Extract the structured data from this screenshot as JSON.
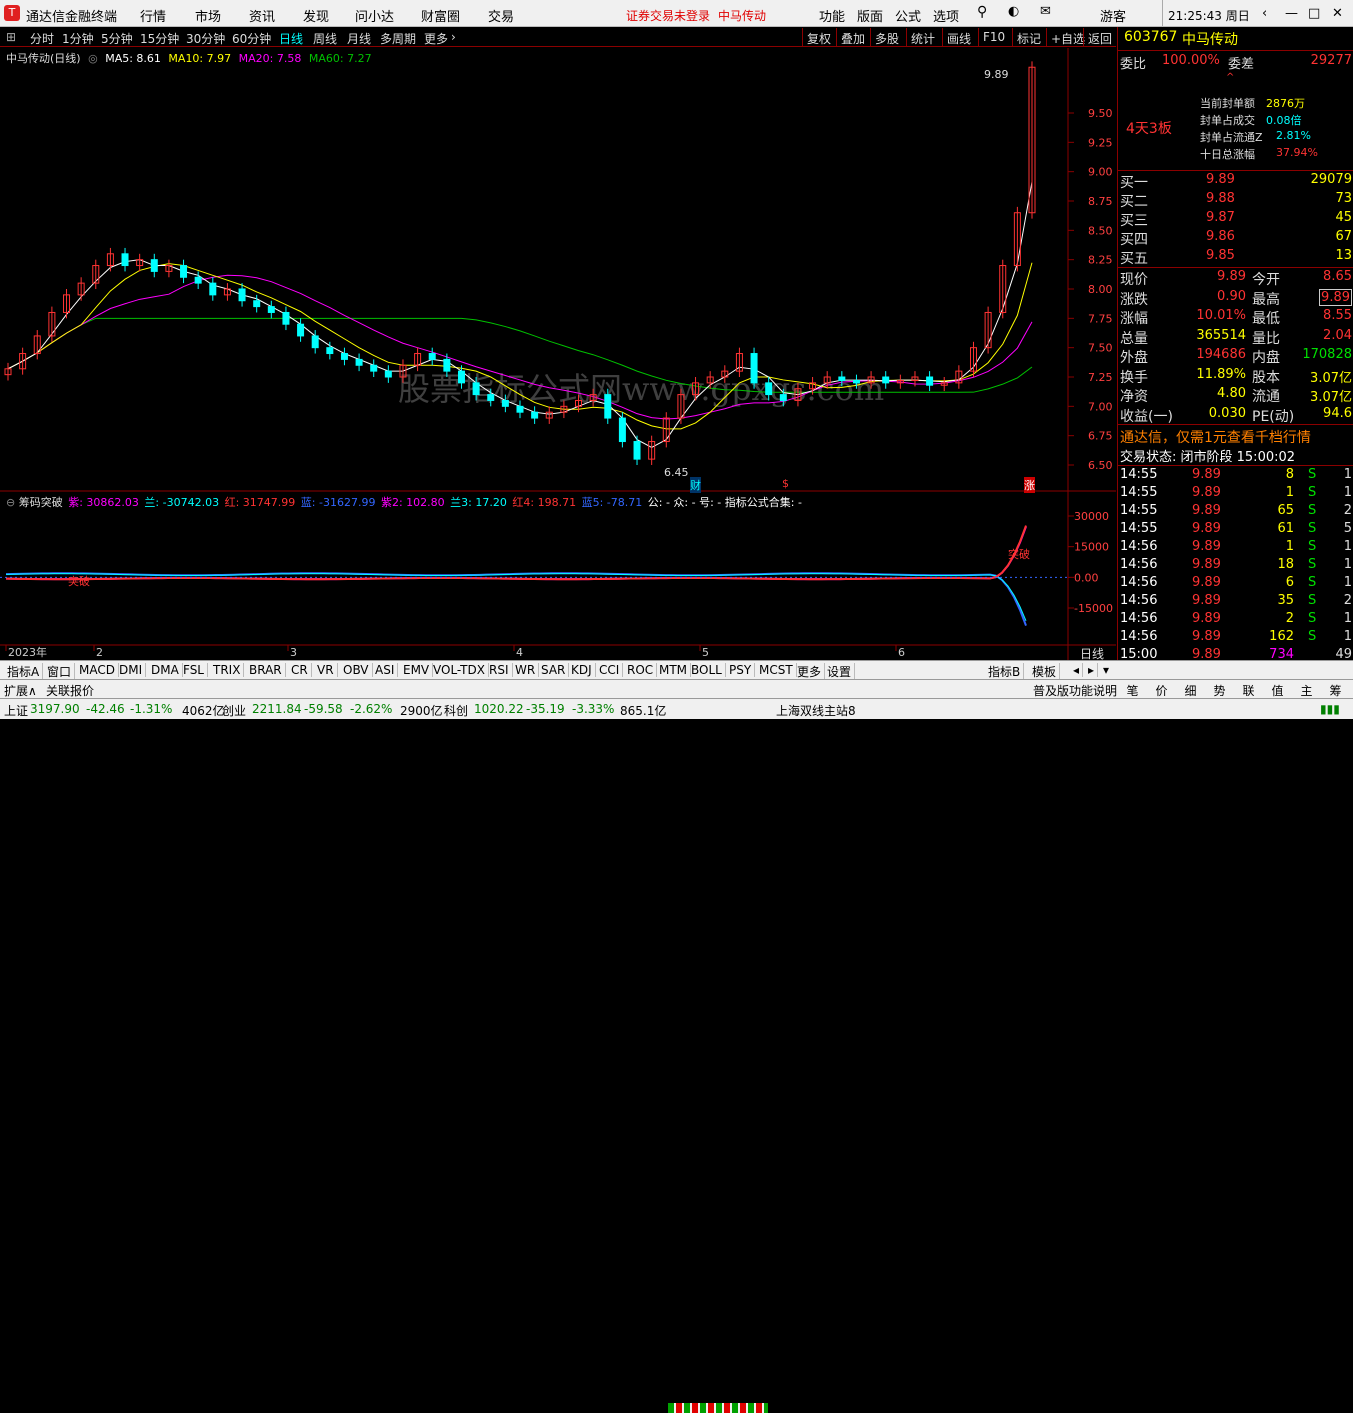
{
  "menubar": {
    "app_title": "通达信金融终端",
    "items": [
      "行情",
      "市场",
      "资讯",
      "发现",
      "问小达",
      "财富圈",
      "交易"
    ],
    "notice": "证券交易未登录",
    "stock_name": "中马传动",
    "right_items": [
      "功能",
      "版面",
      "公式",
      "选项"
    ],
    "guest": "游客",
    "clock": "21:25:43 周日"
  },
  "toolbar": {
    "periods": [
      "分时",
      "1分钟",
      "5分钟",
      "15分钟",
      "30分钟",
      "60分钟",
      "日线",
      "周线",
      "月线",
      "多周期",
      "更多"
    ],
    "active": "日线",
    "buttons": [
      "复权",
      "叠加",
      "多股",
      "统计",
      "画线",
      "F10",
      "标记",
      "+自选",
      "返回"
    ]
  },
  "chart": {
    "title": "中马传动(日线)",
    "ma": [
      {
        "label": "MA5: 8.61",
        "color": "#ffffff"
      },
      {
        "label": "MA10: 7.97",
        "color": "#ffff00"
      },
      {
        "label": "MA20: 7.58",
        "color": "#ff00ff"
      },
      {
        "label": "MA60: 7.27",
        "color": "#00c000"
      }
    ],
    "y_ticks": [
      "9.50",
      "9.25",
      "9.00",
      "8.75",
      "8.50",
      "8.25",
      "8.00",
      "7.75",
      "7.50",
      "7.25",
      "7.00",
      "6.75",
      "6.50"
    ],
    "high_label": "9.89",
    "low_label": "6.45",
    "markers": [
      "财",
      "$",
      "涨"
    ],
    "watermark": "股票指标公式网www.gpxgs.com",
    "x_labels": [
      "2023年",
      "2",
      "3",
      "4",
      "5",
      "6"
    ],
    "right_axis_label": "日线"
  },
  "indicator": {
    "name": "筹码突破",
    "values": [
      {
        "t": "紫: 30862.03",
        "c": "#ff00ff"
      },
      {
        "t": "兰: -30742.03",
        "c": "#00ffff"
      },
      {
        "t": "红: 31747.99",
        "c": "#ff3333"
      },
      {
        "t": "蓝: -31627.99",
        "c": "#3366ff"
      },
      {
        "t": "紫2: 102.80",
        "c": "#ff00ff"
      },
      {
        "t": "兰3: 17.20",
        "c": "#00ffff"
      },
      {
        "t": "红4: 198.71",
        "c": "#ff3333"
      },
      {
        "t": "蓝5: -78.71",
        "c": "#3366ff"
      },
      {
        "t": "公: -  众: -  号: -  指标公式合集: -",
        "c": "#ffffff"
      }
    ],
    "y_ticks": [
      "30000",
      "15000",
      "0.00",
      "-15000"
    ],
    "tags": [
      "突破",
      "突破"
    ]
  },
  "sidebar": {
    "code": "603767",
    "name": "中马传动",
    "weibi_label": "委比",
    "weibi": "100.00%",
    "weicha_label": "委差",
    "weicha": "29277",
    "streak": "4天3板",
    "seal": [
      {
        "k": "当前封单额",
        "v": "2876万"
      },
      {
        "k": "封单占成交",
        "v": "0.08倍"
      },
      {
        "k": "封单占流通Z",
        "v": "2.81%"
      },
      {
        "k": "十日总涨幅",
        "v": "37.94%"
      }
    ],
    "bids": [
      {
        "k": "买一",
        "p": "9.89",
        "v": "29079"
      },
      {
        "k": "买二",
        "p": "9.88",
        "v": "73"
      },
      {
        "k": "买三",
        "p": "9.87",
        "v": "45"
      },
      {
        "k": "买四",
        "p": "9.86",
        "v": "67"
      },
      {
        "k": "买五",
        "p": "9.85",
        "v": "13"
      }
    ],
    "quote": [
      {
        "a": "现价",
        "av": "9.89",
        "b": "今开",
        "bv": "8.65"
      },
      {
        "a": "涨跌",
        "av": "0.90",
        "b": "最高",
        "bv": "9.89"
      },
      {
        "a": "涨幅",
        "av": "10.01%",
        "b": "最低",
        "bv": "8.55"
      },
      {
        "a": "总量",
        "av": "365514",
        "b": "量比",
        "bv": "2.04"
      },
      {
        "a": "外盘",
        "av": "194686",
        "b": "内盘",
        "bv": "170828"
      },
      {
        "a": "换手",
        "av": "11.89%",
        "b": "股本",
        "bv": "3.07亿"
      },
      {
        "a": "净资",
        "av": "4.80",
        "b": "流通",
        "bv": "3.07亿"
      },
      {
        "a": "收益(一)",
        "av": "0.030",
        "b": "PE(动)",
        "bv": "94.6"
      }
    ],
    "promo": "通达信，仅需1元查看千档行情",
    "trade_state": "交易状态: 闭市阶段 15:00:02",
    "ticks": [
      {
        "t": "14:55",
        "p": "9.89",
        "v": "8",
        "s": "S",
        "n": "1"
      },
      {
        "t": "14:55",
        "p": "9.89",
        "v": "1",
        "s": "S",
        "n": "1"
      },
      {
        "t": "14:55",
        "p": "9.89",
        "v": "65",
        "s": "S",
        "n": "2"
      },
      {
        "t": "14:55",
        "p": "9.89",
        "v": "61",
        "s": "S",
        "n": "5"
      },
      {
        "t": "14:56",
        "p": "9.89",
        "v": "1",
        "s": "S",
        "n": "1"
      },
      {
        "t": "14:56",
        "p": "9.89",
        "v": "18",
        "s": "S",
        "n": "1"
      },
      {
        "t": "14:56",
        "p": "9.89",
        "v": "6",
        "s": "S",
        "n": "1"
      },
      {
        "t": "14:56",
        "p": "9.89",
        "v": "35",
        "s": "S",
        "n": "2"
      },
      {
        "t": "14:56",
        "p": "9.89",
        "v": "2",
        "s": "S",
        "n": "1"
      },
      {
        "t": "14:56",
        "p": "9.89",
        "v": "162",
        "s": "S",
        "n": "1"
      },
      {
        "t": "15:00",
        "p": "9.89",
        "v": "734",
        "s": "",
        "n": "49"
      }
    ]
  },
  "bottom_tabs": [
    "指标A",
    "窗口",
    "MACD",
    "DMI",
    "DMA",
    "FSL",
    "TRIX",
    "BRAR",
    "CR",
    "VR",
    "OBV",
    "ASI",
    "EMV",
    "VOL-TDX",
    "RSI",
    "WR",
    "SAR",
    "KDJ",
    "CCI",
    "ROC",
    "MTM",
    "BOLL",
    "PSY",
    "MCST",
    "更多",
    "设置"
  ],
  "bottom_right": [
    "指标B",
    "模板"
  ],
  "bottom2": {
    "left": [
      "扩展∧",
      "关联报价"
    ],
    "right_label": "普及版功能说明",
    "right_tabs": [
      "笔",
      "价",
      "细",
      "势",
      "联",
      "值",
      "主",
      "筹"
    ]
  },
  "status": [
    {
      "k": "上证",
      "v": "3197.90",
      "c": "-42.46",
      "p": "-1.31%",
      "a": "4062亿"
    },
    {
      "k": "创业",
      "v": "2211.84",
      "c": "-59.58",
      "p": "-2.62%",
      "a": "2900亿"
    },
    {
      "k": "科创",
      "v": "1020.22",
      "c": "-35.19",
      "p": "-3.33%",
      "a": "865.1亿"
    }
  ],
  "station": "上海双线主站8"
}
